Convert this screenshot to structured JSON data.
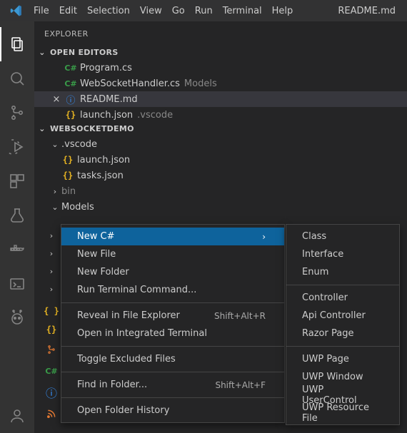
{
  "menubar": {
    "items": [
      "File",
      "Edit",
      "Selection",
      "View",
      "Go",
      "Run",
      "Terminal",
      "Help"
    ],
    "title": "README.md"
  },
  "sidebar": {
    "title": "EXPLORER",
    "open_editors_header": "OPEN EDITORS",
    "open_editors": [
      {
        "icon": "cs",
        "label": "Program.cs",
        "dim": ""
      },
      {
        "icon": "cs",
        "label": "WebSocketHandler.cs",
        "dim": "Models"
      },
      {
        "icon": "info",
        "label": "README.md",
        "dim": "",
        "active": true
      },
      {
        "icon": "json",
        "label": "launch.json",
        "dim": ".vscode"
      }
    ],
    "project_header": "WEBSOCKETDEMO",
    "tree_items": [
      {
        "type": "folder",
        "open": true,
        "label": ".vscode",
        "depth": 1
      },
      {
        "type": "file",
        "icon": "json",
        "label": "launch.json",
        "depth": 2
      },
      {
        "type": "file",
        "icon": "json",
        "label": "tasks.json",
        "depth": 2
      },
      {
        "type": "folder",
        "open": false,
        "label": "bin",
        "depth": 1,
        "dim": true
      },
      {
        "type": "folder",
        "open": true,
        "label": "Models",
        "depth": 1
      }
    ]
  },
  "rail_icons": [
    "json2",
    "json",
    "git",
    "cs",
    "info",
    "rss"
  ],
  "context_menu": {
    "items": [
      {
        "label": "New C#",
        "sub": true,
        "hl": true
      },
      {
        "label": "New File"
      },
      {
        "label": "New Folder"
      },
      {
        "label": "Run Terminal Command..."
      },
      {
        "sep": true
      },
      {
        "label": "Reveal in File Explorer",
        "shortcut": "Shift+Alt+R"
      },
      {
        "label": "Open in Integrated Terminal"
      },
      {
        "sep": true
      },
      {
        "label": "Toggle Excluded Files"
      },
      {
        "sep": true
      },
      {
        "label": "Find in Folder...",
        "shortcut": "Shift+Alt+F"
      },
      {
        "sep": true
      },
      {
        "label": "Open Folder History"
      }
    ]
  },
  "submenu": {
    "items": [
      {
        "label": "Class"
      },
      {
        "label": "Interface"
      },
      {
        "label": "Enum"
      },
      {
        "sep": true
      },
      {
        "label": "Controller"
      },
      {
        "label": "Api Controller"
      },
      {
        "label": "Razor Page"
      },
      {
        "sep": true
      },
      {
        "label": "UWP Page"
      },
      {
        "label": "UWP Window"
      },
      {
        "label": "UWP UserControl"
      },
      {
        "label": "UWP Resource File"
      }
    ]
  }
}
